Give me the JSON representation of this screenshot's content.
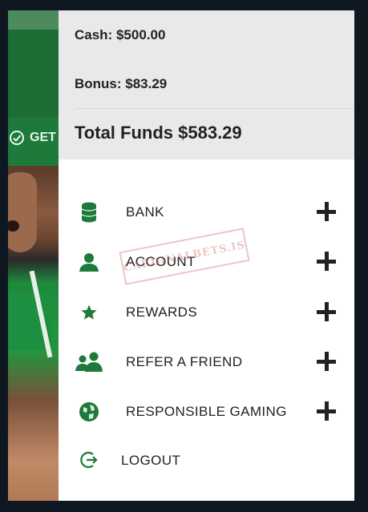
{
  "background": {
    "get_label": "GET",
    "colors": {
      "panel": "#1f7a3a",
      "page": "#0f1820"
    }
  },
  "funds": {
    "cash": "Cash: $500.00",
    "bonus": "Bonus: $83.29",
    "total": "Total Funds $583.29"
  },
  "menu": {
    "items": [
      {
        "label": "BANK",
        "icon": "coins-stack-icon"
      },
      {
        "label": "ACCOUNT",
        "icon": "user-icon"
      },
      {
        "label": "REWARDS",
        "icon": "star-icon"
      },
      {
        "label": "REFER A FRIEND",
        "icon": "users-icon"
      },
      {
        "label": "RESPONSIBLE GAMING",
        "icon": "globe-icon"
      }
    ],
    "logout_label": "LOGOUT"
  },
  "watermark": "CARDINALBETS.IS",
  "accent_color": "#1e7a3b"
}
